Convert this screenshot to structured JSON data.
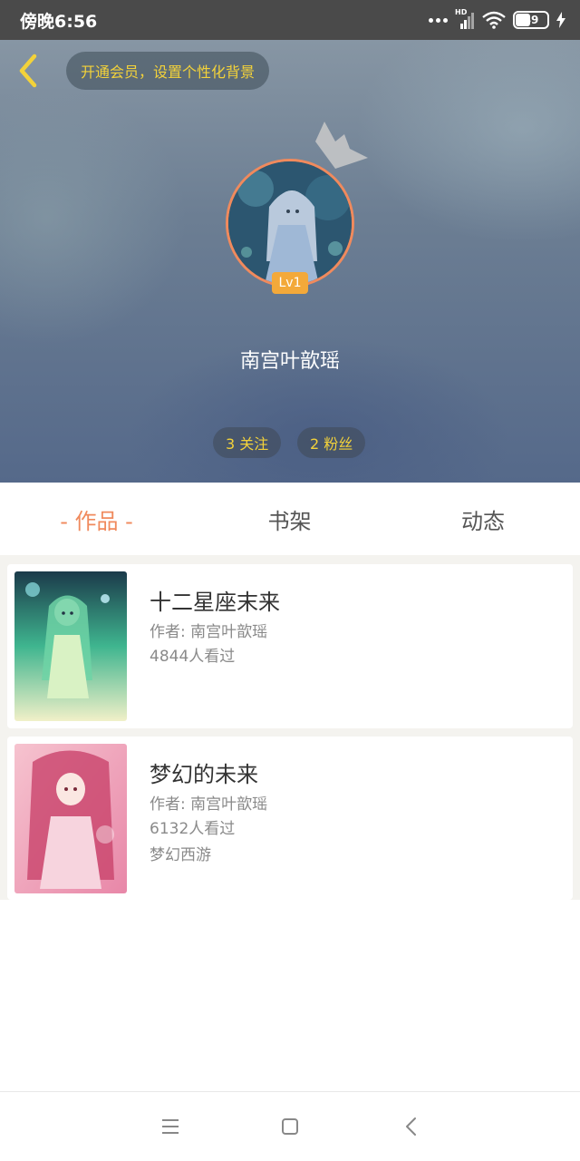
{
  "status_bar": {
    "time": "傍晚6:56",
    "network_label": "HD",
    "battery": "49",
    "icons": [
      "more-dots-icon",
      "signal-icon",
      "wifi-icon",
      "battery-icon",
      "charging-icon"
    ]
  },
  "header": {
    "vip_banner": "开通会员，设置个性化背景",
    "level": "Lv1",
    "user_name": "南宫叶歆瑶",
    "following": "3 关注",
    "followers": "2 粉丝"
  },
  "tabs": [
    {
      "label": "- 作品 -",
      "active": true
    },
    {
      "label": "书架",
      "active": false
    },
    {
      "label": "动态",
      "active": false
    }
  ],
  "works": [
    {
      "title": "十二星座末来",
      "author": "作者: 南宫叶歆瑶",
      "views": "4844人看过"
    },
    {
      "title": "梦幻的未来",
      "author": "作者: 南宫叶歆瑶",
      "views": "6132人看过",
      "category": "梦幻西游"
    }
  ],
  "nav": {
    "icons": [
      "menu-icon",
      "home-icon",
      "back-icon"
    ]
  },
  "colors": {
    "accent": "#f08a5d",
    "gold": "#f3d23a",
    "badge": "#f3a93a",
    "status_bar": "#4a4a4a"
  }
}
